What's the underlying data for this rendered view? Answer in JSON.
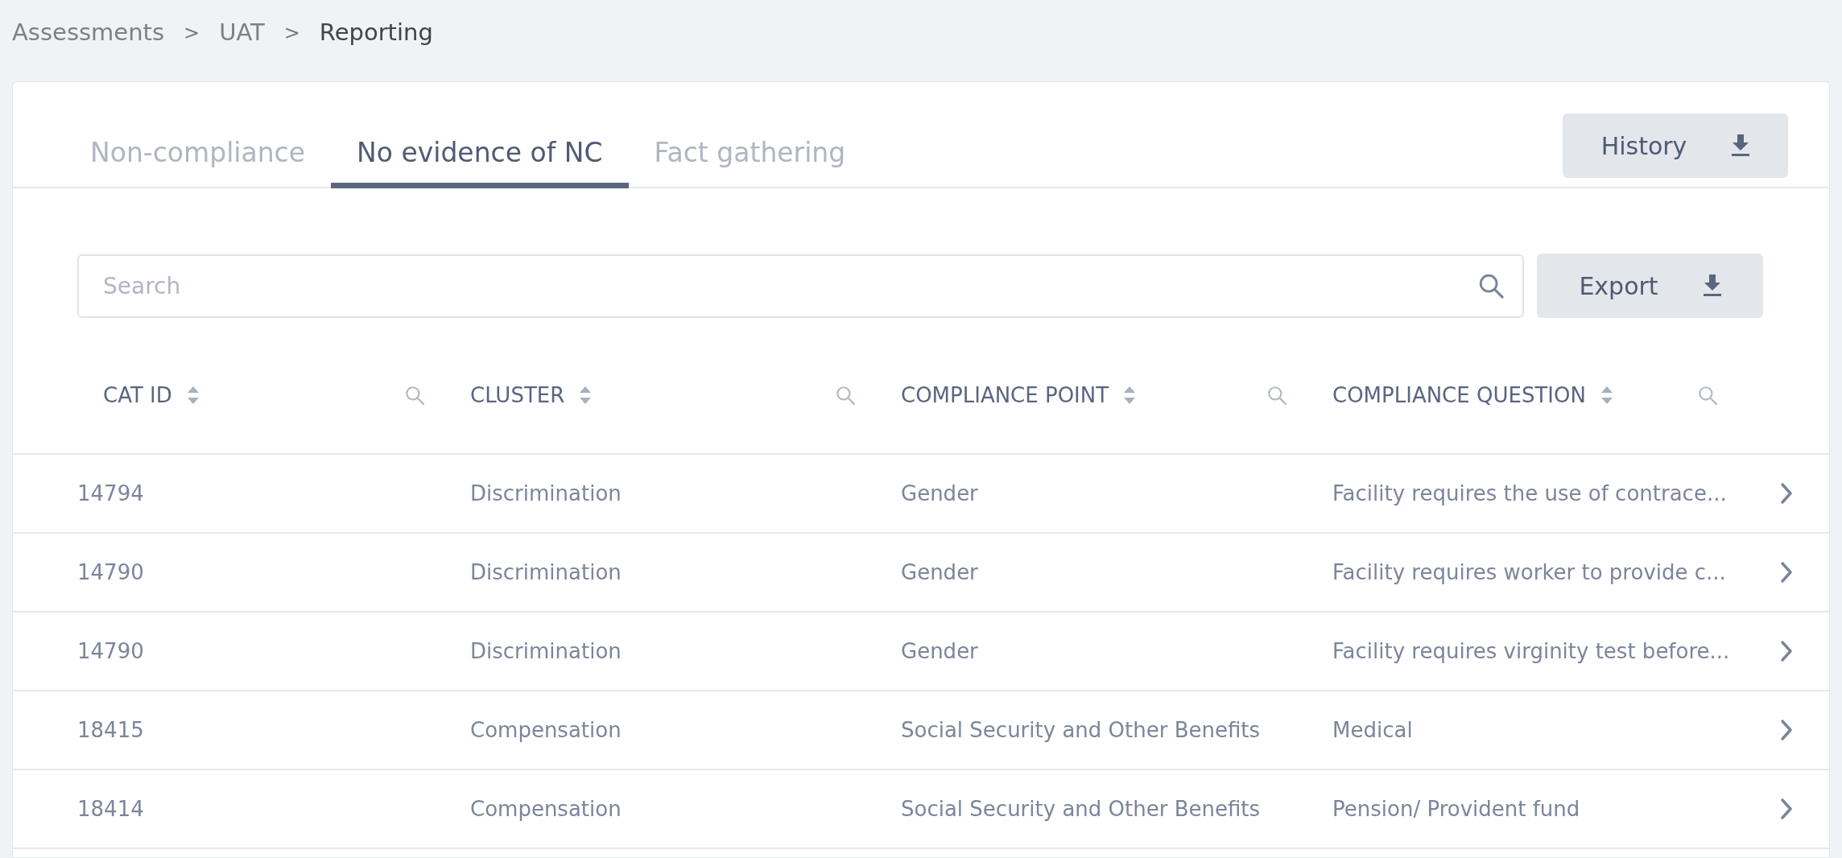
{
  "breadcrumb": [
    {
      "label": "Assessments",
      "current": false
    },
    {
      "label": "UAT",
      "current": false
    },
    {
      "label": "Reporting",
      "current": true
    }
  ],
  "breadcrumb_separator": ">",
  "tabs": [
    {
      "label": "Non-compliance",
      "selected": false
    },
    {
      "label": "No evidence of NC",
      "selected": true
    },
    {
      "label": "Fact gathering",
      "selected": false
    }
  ],
  "history_button": "History",
  "search": {
    "placeholder": "Search"
  },
  "export_button": "Export",
  "table": {
    "columns": [
      "CAT ID",
      "CLUSTER",
      "COMPLIANCE POINT",
      "COMPLIANCE QUESTION"
    ],
    "rows": [
      [
        "14794",
        "Discrimination",
        "Gender",
        "Facility requires the use of contrace..."
      ],
      [
        "14790",
        "Discrimination",
        "Gender",
        "Facility requires worker to provide c..."
      ],
      [
        "14790",
        "Discrimination",
        "Gender",
        "Facility requires virginity test before..."
      ],
      [
        "18415",
        "Compensation",
        "Social Security and Other Benefits",
        "Medical"
      ],
      [
        "18414",
        "Compensation",
        "Social Security and Other Benefits",
        "Pension/ Provident fund"
      ]
    ]
  }
}
